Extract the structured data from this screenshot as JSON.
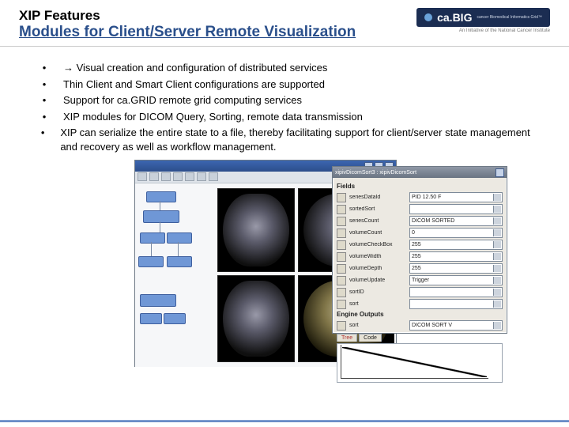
{
  "header": {
    "title_line1": "XIP Features",
    "title_line2": "Modules for Client/Server Remote Visualization",
    "logo_text": "ca.BIG",
    "logo_sub": "cancer Biomedical Informatics Grid™",
    "logo_tag": "An Initiative of the National Cancer Institute"
  },
  "bullets": [
    "→ Visual creation and configuration of distributed services",
    "Thin Client and Smart Client configurations are supported",
    "Support for ca.GRID remote grid computing services",
    "XIP modules for DICOM Query, Sorting, remote data transmission",
    "XIP can serialize the entire state to a file, thereby facilitating support for client/server state management and recovery as well as workflow management."
  ],
  "screenshot": {
    "main_title": "",
    "prop_title": "xipivDicomSort3 : xipivDicomSort",
    "fields_section": "Fields",
    "fields": [
      {
        "name": "seriesDataId",
        "value": "PID 12.50 F"
      },
      {
        "name": "sortedSort",
        "value": ""
      },
      {
        "name": "seriesCount",
        "value": "DICOM SORTED"
      },
      {
        "name": "volumeCount",
        "value": "0"
      },
      {
        "name": "volumeCheckBox",
        "value": "255"
      },
      {
        "name": "volumeWidth",
        "value": "255"
      },
      {
        "name": "volumeDepth",
        "value": "255"
      },
      {
        "name": "volumeUpdate",
        "value": "Trigger"
      },
      {
        "name": "sortID",
        "value": ""
      },
      {
        "name": "sort",
        "value": ""
      }
    ],
    "section2": "Engine Outputs",
    "fields2": [
      {
        "name": "sort",
        "value": "DICOM SORT V"
      }
    ],
    "tabs": [
      "Tree",
      "Code"
    ]
  }
}
